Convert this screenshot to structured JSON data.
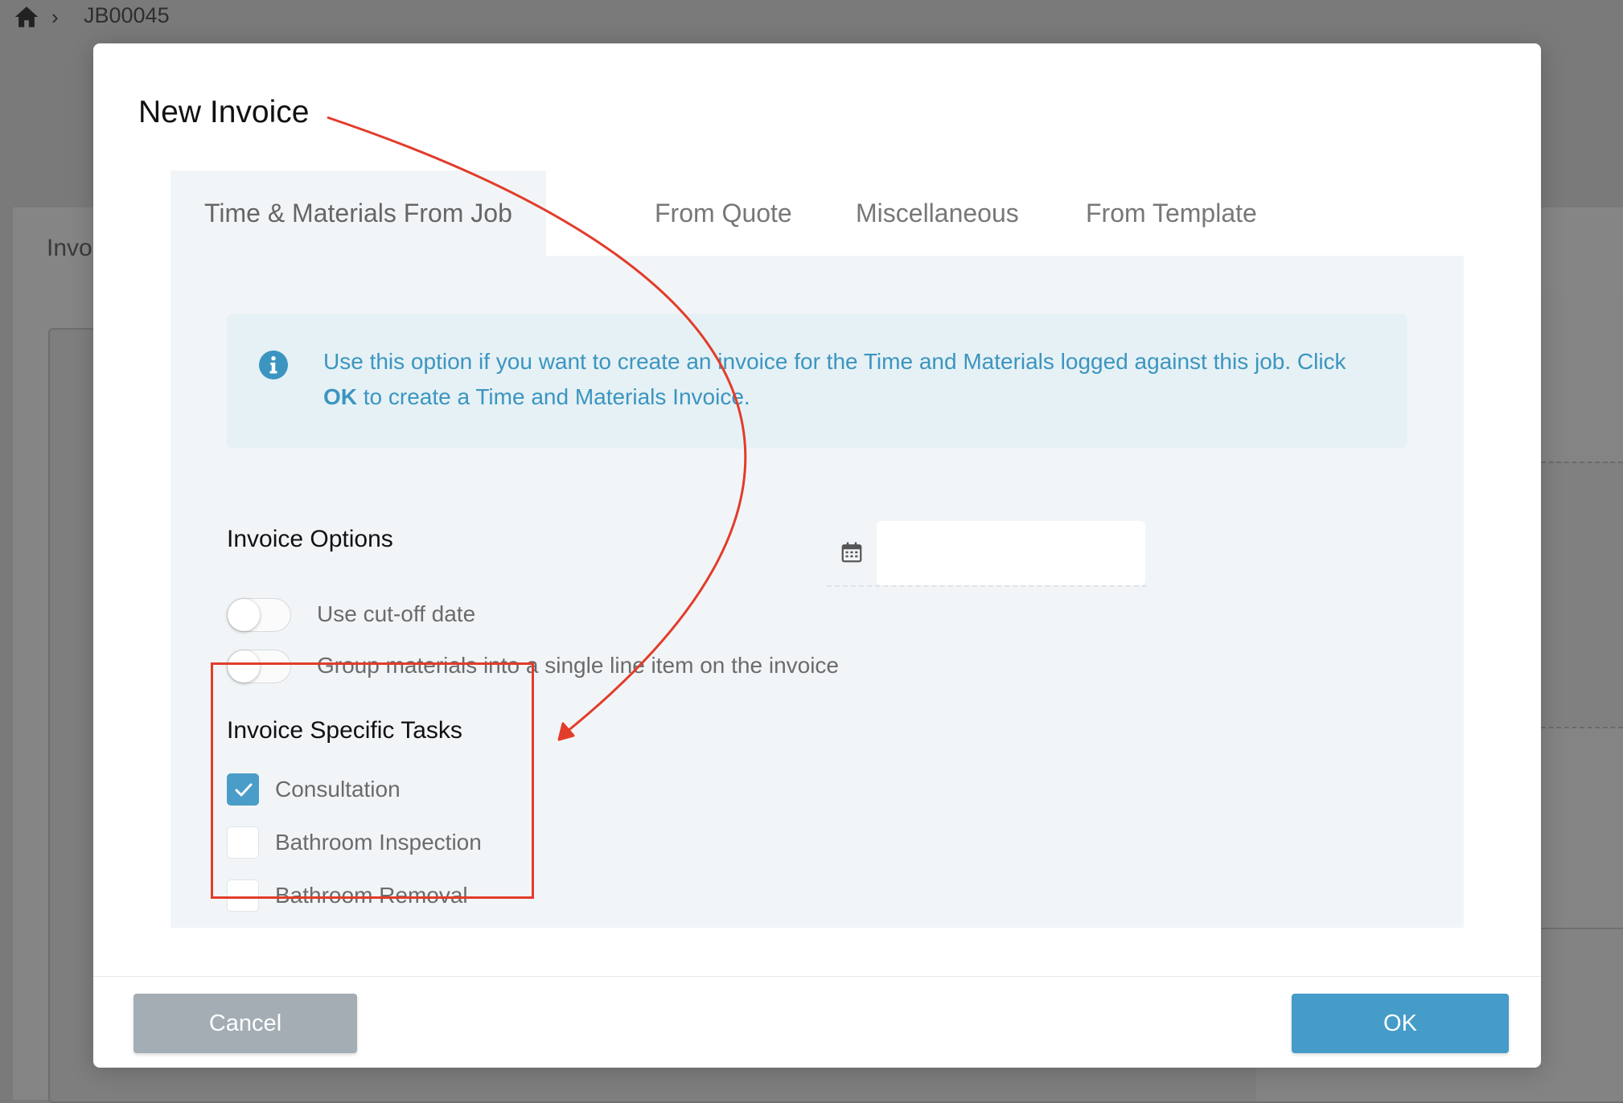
{
  "breadcrumb": {
    "home_icon": "home-icon",
    "separator_icon": "chevron-right-icon",
    "job_id": "JB00045"
  },
  "background": {
    "section_label": "Invo"
  },
  "modal": {
    "title": "New Invoice",
    "tabs": [
      {
        "label": "Time & Materials From Job",
        "active": true
      },
      {
        "label": "From Quote",
        "active": false
      },
      {
        "label": "Miscellaneous",
        "active": false
      },
      {
        "label": "From Template",
        "active": false
      }
    ],
    "info": {
      "icon": "info-icon",
      "text_before": "Use this option if you want to create an invoice for the Time and Materials logged against this job. Click ",
      "text_bold": "OK",
      "text_after": " to create a Time and Materials Invoice."
    },
    "invoice_options": {
      "title": "Invoice Options",
      "options": [
        {
          "label": "Use cut-off date",
          "enabled": false
        },
        {
          "label": "Group materials into a single line item on the invoice",
          "enabled": false
        }
      ],
      "date_field": {
        "icon": "calendar-icon",
        "value": "",
        "placeholder": ""
      }
    },
    "tasks": {
      "title": "Invoice Specific Tasks",
      "items": [
        {
          "label": "Consultation",
          "checked": true
        },
        {
          "label": "Bathroom Inspection",
          "checked": false
        },
        {
          "label": "Bathroom Removal",
          "checked": false
        }
      ]
    },
    "buttons": {
      "cancel": "Cancel",
      "ok": "OK"
    }
  },
  "colors": {
    "accent": "#459cc8",
    "annotation": "#e23c2a",
    "info_text": "#3b95c0",
    "cancel_button": "#a4adb3"
  }
}
